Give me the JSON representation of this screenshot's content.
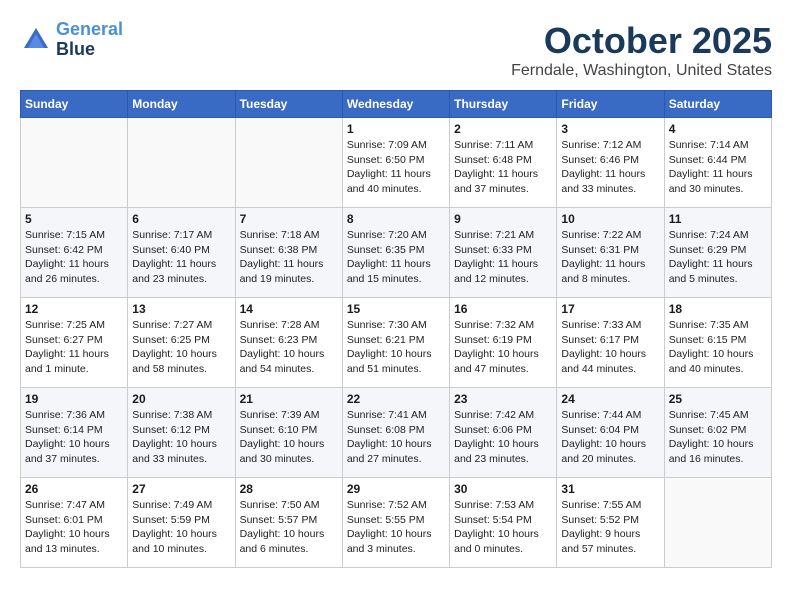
{
  "header": {
    "logo_line1": "General",
    "logo_line2": "Blue",
    "title": "October 2025",
    "subtitle": "Ferndale, Washington, United States"
  },
  "weekdays": [
    "Sunday",
    "Monday",
    "Tuesday",
    "Wednesday",
    "Thursday",
    "Friday",
    "Saturday"
  ],
  "weeks": [
    [
      {
        "num": "",
        "detail": ""
      },
      {
        "num": "",
        "detail": ""
      },
      {
        "num": "",
        "detail": ""
      },
      {
        "num": "1",
        "detail": "Sunrise: 7:09 AM\nSunset: 6:50 PM\nDaylight: 11 hours\nand 40 minutes."
      },
      {
        "num": "2",
        "detail": "Sunrise: 7:11 AM\nSunset: 6:48 PM\nDaylight: 11 hours\nand 37 minutes."
      },
      {
        "num": "3",
        "detail": "Sunrise: 7:12 AM\nSunset: 6:46 PM\nDaylight: 11 hours\nand 33 minutes."
      },
      {
        "num": "4",
        "detail": "Sunrise: 7:14 AM\nSunset: 6:44 PM\nDaylight: 11 hours\nand 30 minutes."
      }
    ],
    [
      {
        "num": "5",
        "detail": "Sunrise: 7:15 AM\nSunset: 6:42 PM\nDaylight: 11 hours\nand 26 minutes."
      },
      {
        "num": "6",
        "detail": "Sunrise: 7:17 AM\nSunset: 6:40 PM\nDaylight: 11 hours\nand 23 minutes."
      },
      {
        "num": "7",
        "detail": "Sunrise: 7:18 AM\nSunset: 6:38 PM\nDaylight: 11 hours\nand 19 minutes."
      },
      {
        "num": "8",
        "detail": "Sunrise: 7:20 AM\nSunset: 6:35 PM\nDaylight: 11 hours\nand 15 minutes."
      },
      {
        "num": "9",
        "detail": "Sunrise: 7:21 AM\nSunset: 6:33 PM\nDaylight: 11 hours\nand 12 minutes."
      },
      {
        "num": "10",
        "detail": "Sunrise: 7:22 AM\nSunset: 6:31 PM\nDaylight: 11 hours\nand 8 minutes."
      },
      {
        "num": "11",
        "detail": "Sunrise: 7:24 AM\nSunset: 6:29 PM\nDaylight: 11 hours\nand 5 minutes."
      }
    ],
    [
      {
        "num": "12",
        "detail": "Sunrise: 7:25 AM\nSunset: 6:27 PM\nDaylight: 11 hours\nand 1 minute."
      },
      {
        "num": "13",
        "detail": "Sunrise: 7:27 AM\nSunset: 6:25 PM\nDaylight: 10 hours\nand 58 minutes."
      },
      {
        "num": "14",
        "detail": "Sunrise: 7:28 AM\nSunset: 6:23 PM\nDaylight: 10 hours\nand 54 minutes."
      },
      {
        "num": "15",
        "detail": "Sunrise: 7:30 AM\nSunset: 6:21 PM\nDaylight: 10 hours\nand 51 minutes."
      },
      {
        "num": "16",
        "detail": "Sunrise: 7:32 AM\nSunset: 6:19 PM\nDaylight: 10 hours\nand 47 minutes."
      },
      {
        "num": "17",
        "detail": "Sunrise: 7:33 AM\nSunset: 6:17 PM\nDaylight: 10 hours\nand 44 minutes."
      },
      {
        "num": "18",
        "detail": "Sunrise: 7:35 AM\nSunset: 6:15 PM\nDaylight: 10 hours\nand 40 minutes."
      }
    ],
    [
      {
        "num": "19",
        "detail": "Sunrise: 7:36 AM\nSunset: 6:14 PM\nDaylight: 10 hours\nand 37 minutes."
      },
      {
        "num": "20",
        "detail": "Sunrise: 7:38 AM\nSunset: 6:12 PM\nDaylight: 10 hours\nand 33 minutes."
      },
      {
        "num": "21",
        "detail": "Sunrise: 7:39 AM\nSunset: 6:10 PM\nDaylight: 10 hours\nand 30 minutes."
      },
      {
        "num": "22",
        "detail": "Sunrise: 7:41 AM\nSunset: 6:08 PM\nDaylight: 10 hours\nand 27 minutes."
      },
      {
        "num": "23",
        "detail": "Sunrise: 7:42 AM\nSunset: 6:06 PM\nDaylight: 10 hours\nand 23 minutes."
      },
      {
        "num": "24",
        "detail": "Sunrise: 7:44 AM\nSunset: 6:04 PM\nDaylight: 10 hours\nand 20 minutes."
      },
      {
        "num": "25",
        "detail": "Sunrise: 7:45 AM\nSunset: 6:02 PM\nDaylight: 10 hours\nand 16 minutes."
      }
    ],
    [
      {
        "num": "26",
        "detail": "Sunrise: 7:47 AM\nSunset: 6:01 PM\nDaylight: 10 hours\nand 13 minutes."
      },
      {
        "num": "27",
        "detail": "Sunrise: 7:49 AM\nSunset: 5:59 PM\nDaylight: 10 hours\nand 10 minutes."
      },
      {
        "num": "28",
        "detail": "Sunrise: 7:50 AM\nSunset: 5:57 PM\nDaylight: 10 hours\nand 6 minutes."
      },
      {
        "num": "29",
        "detail": "Sunrise: 7:52 AM\nSunset: 5:55 PM\nDaylight: 10 hours\nand 3 minutes."
      },
      {
        "num": "30",
        "detail": "Sunrise: 7:53 AM\nSunset: 5:54 PM\nDaylight: 10 hours\nand 0 minutes."
      },
      {
        "num": "31",
        "detail": "Sunrise: 7:55 AM\nSunset: 5:52 PM\nDaylight: 9 hours\nand 57 minutes."
      },
      {
        "num": "",
        "detail": ""
      }
    ]
  ]
}
